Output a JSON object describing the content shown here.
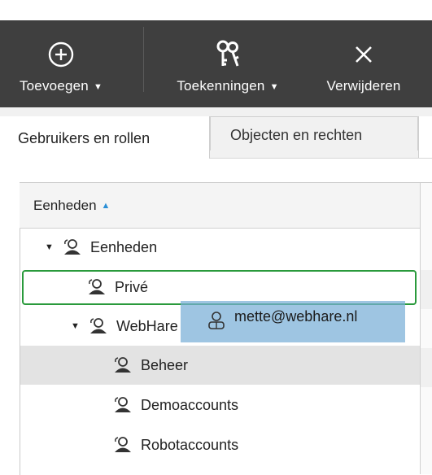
{
  "toolbar": {
    "buttons": [
      {
        "label": "Toevoegen",
        "icon": "plus-circle-icon",
        "dropdown": true
      },
      {
        "label": "Toekenningen",
        "icon": "keys-icon",
        "dropdown": true
      },
      {
        "label": "Verwijderen",
        "icon": "close-icon",
        "dropdown": false
      }
    ],
    "caret": "▼"
  },
  "tabs": [
    {
      "label": "Gebruikers en rollen",
      "active": true
    },
    {
      "label": "Objecten en rechten",
      "active": false
    }
  ],
  "tree": {
    "column_header": "Eenheden",
    "sort_indicator": "▲",
    "expand_glyph": "▼",
    "rows": [
      {
        "label": "Eenheden",
        "expanded": true,
        "selected": false
      },
      {
        "label": "Privé",
        "expanded": false,
        "selected": false,
        "drop_target": true
      },
      {
        "label": "WebHare",
        "expanded": true,
        "selected": false
      },
      {
        "label": "Beheer",
        "expanded": false,
        "selected": true
      },
      {
        "label": "Demoaccounts",
        "expanded": false,
        "selected": false
      },
      {
        "label": "Robotaccounts",
        "expanded": false,
        "selected": false
      }
    ]
  },
  "drag_item": {
    "label": "mette@webhare.nl",
    "icon": "user-icon"
  },
  "colors": {
    "toolbar_bg": "#3f3f3f",
    "focus_border": "#2a9a3c",
    "drag_bg": "#78afd7",
    "selected_row": "#e3e3e3",
    "sort_arrow": "#2a8fd6"
  }
}
